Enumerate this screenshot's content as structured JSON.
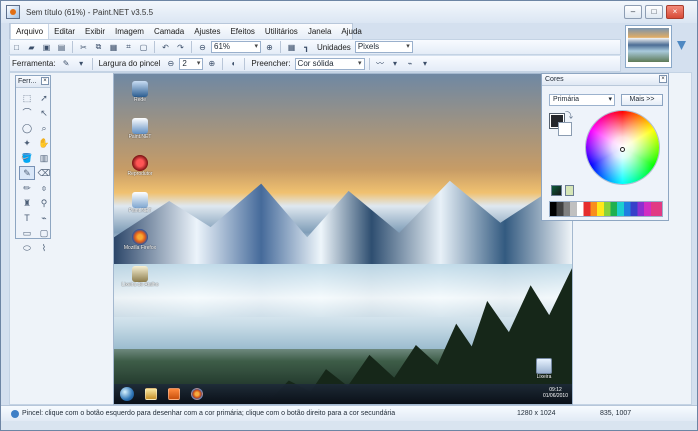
{
  "window": {
    "title": "Sem título (61%) - Paint.NET v3.5.5",
    "controls": [
      "–",
      "□",
      "×"
    ]
  },
  "menu": {
    "items": [
      {
        "label": "Arquivo"
      },
      {
        "label": "Editar"
      },
      {
        "label": "Exibir"
      },
      {
        "label": "Imagem"
      },
      {
        "label": "Camada"
      },
      {
        "label": "Ajustes"
      },
      {
        "label": "Efeitos"
      },
      {
        "label": "Utilitários"
      },
      {
        "label": "Janela"
      },
      {
        "label": "Ajuda"
      }
    ]
  },
  "toolbar": {
    "zoom_value": "61%",
    "units_label": "Unidades",
    "units_value": "Pixels",
    "tool_label": "Ferramenta:",
    "brush_label": "Largura do pincel",
    "brush_value": "2",
    "fill_label": "Preencher:",
    "fill_value": "Cor sólida"
  },
  "tools_window": {
    "title": "Ferr...",
    "close": "×"
  },
  "desktop_icons": [
    {
      "label": "Rede"
    },
    {
      "label": "Paint.NET"
    },
    {
      "label": "Reprodutor"
    },
    {
      "label": "Paint.NET"
    },
    {
      "label": "Mozilla Firefox"
    },
    {
      "label": "Lixeira de Atalho"
    }
  ],
  "recycle_bin": {
    "label": "Lixeira"
  },
  "taskbar_clock": {
    "time": "09:12",
    "date": "01/06/2010"
  },
  "colors_window": {
    "title": "Cores",
    "close": "×",
    "mode": "Primária",
    "more_label": "Mais >>"
  },
  "status": {
    "message": "Pincel: clique com o botão esquerdo para desenhar com a cor primária; clique com o botão direito para a cor secundária",
    "image_size": "1280 x 1024",
    "cursor_pos": "835, 1007"
  }
}
